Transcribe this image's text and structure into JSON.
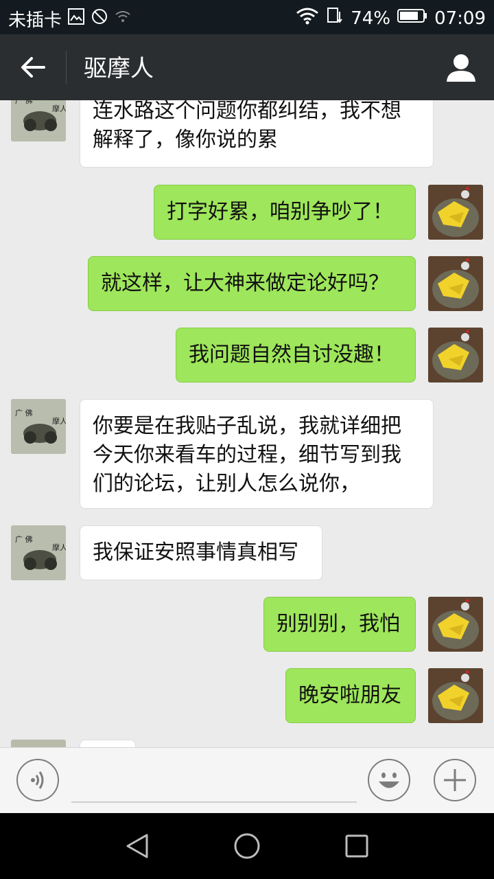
{
  "status_bar": {
    "carrier": "未插卡",
    "battery": "74%",
    "time": "07:09"
  },
  "header": {
    "title": "驱摩人"
  },
  "messages": [
    {
      "side": "left",
      "text": "连水路这个问题你都纠结，我不想\n解释了，像你说的累"
    },
    {
      "side": "right",
      "text": "打字好累，咱别争吵了！"
    },
    {
      "side": "right",
      "text": "就这样，让大神来做定论好吗？"
    },
    {
      "side": "right",
      "text": "我问题自然自讨没趣！"
    },
    {
      "side": "left",
      "text": "你要是在我贴子乱说，我就详细把\n今天你来看车的过程，细节写到我\n们的论坛，让别人怎么说你，"
    },
    {
      "side": "left",
      "text": "我保证安照事情真相写"
    },
    {
      "side": "right",
      "text": "别别别，我怕"
    },
    {
      "side": "right",
      "text": "晚安啦朋友"
    }
  ],
  "avatar_left_text": "广 佛 摩 人",
  "colors": {
    "bubble_right": "#9ee65b",
    "bubble_left": "#ffffff",
    "header_bg": "#2b2e31",
    "status_bg": "#131b20"
  },
  "icons": [
    "back-arrow-icon",
    "profile-icon",
    "voice-icon",
    "emoji-icon",
    "plus-icon",
    "nav-back-icon",
    "nav-home-icon",
    "nav-recents-icon"
  ]
}
